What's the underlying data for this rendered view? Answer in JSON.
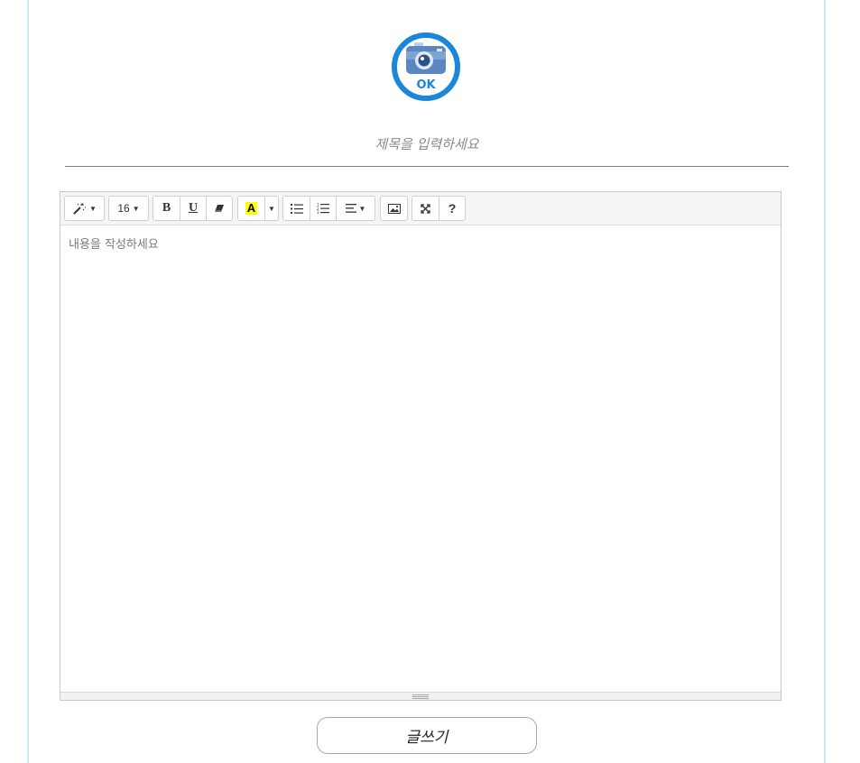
{
  "title_input": {
    "placeholder": "제목을 입력하세요",
    "value": ""
  },
  "editor": {
    "placeholder": "내용을 작성하세요",
    "toolbar": {
      "style_icon": "magic-wand-icon",
      "font_size": "16",
      "bold": "B",
      "underline": "U",
      "eraser_icon": "eraser-icon",
      "highlight": "A",
      "highlight_color": "#ffff00",
      "unordered_list_icon": "unordered-list-icon",
      "ordered_list_icon": "ordered-list-icon",
      "align_icon": "align-left-icon",
      "picture_icon": "picture-icon",
      "fullscreen_icon": "fullscreen-icon",
      "help": "?"
    }
  },
  "submit_button": {
    "label": "글쓰기"
  },
  "colors": {
    "frame_border": "#cfe6f6",
    "logo_blue": "#1c86d9"
  }
}
